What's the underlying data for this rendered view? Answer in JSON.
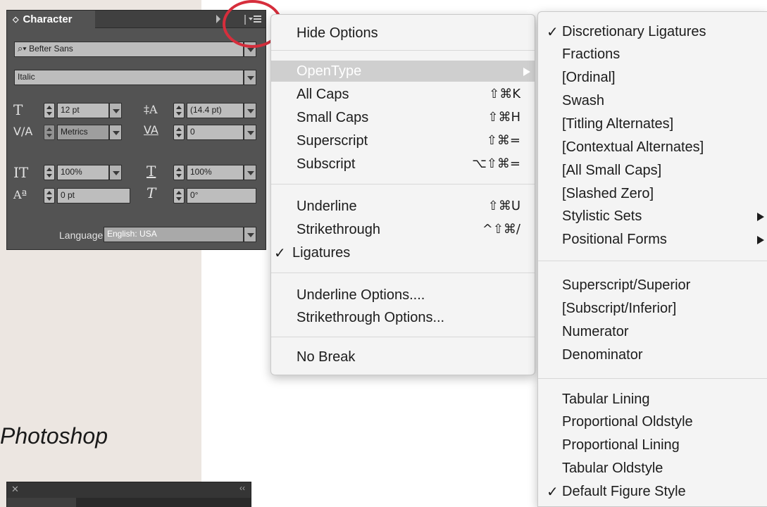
{
  "panel": {
    "title": "Character",
    "font_family": "Befter Sans",
    "font_style": "Italic",
    "font_size": "12 pt",
    "leading": "(14.4 pt)",
    "kerning": "Metrics",
    "tracking": "0",
    "vertical_scale": "100%",
    "horizontal_scale": "100%",
    "baseline_shift": "0 pt",
    "skew": "0°",
    "language_label": "Language:",
    "language_value": "English: USA"
  },
  "photoshop_label": "Photoshop",
  "menu_main": {
    "items": [
      {
        "label": "Hide Options",
        "shortcut": ""
      },
      {
        "label": "OpenType",
        "shortcut": ""
      },
      {
        "label": "All Caps",
        "shortcut": "⇧⌘K"
      },
      {
        "label": "Small Caps",
        "shortcut": "⇧⌘H"
      },
      {
        "label": "Superscript",
        "shortcut": "⇧⌘="
      },
      {
        "label": "Subscript",
        "shortcut": "⌥⇧⌘="
      },
      {
        "label": "Underline",
        "shortcut": "⇧⌘U"
      },
      {
        "label": "Strikethrough",
        "shortcut": "^⇧⌘/"
      },
      {
        "label": "Ligatures",
        "shortcut": "",
        "checked": true
      },
      {
        "label": "Underline Options....",
        "shortcut": ""
      },
      {
        "label": "Strikethrough Options...",
        "shortcut": ""
      },
      {
        "label": "No Break",
        "shortcut": ""
      }
    ]
  },
  "menu_opentype": {
    "items": [
      {
        "label": "Discretionary Ligatures",
        "checked": true
      },
      {
        "label": "Fractions"
      },
      {
        "label": "[Ordinal]"
      },
      {
        "label": "Swash"
      },
      {
        "label": "[Titling Alternates]"
      },
      {
        "label": "[Contextual Alternates]"
      },
      {
        "label": "[All Small Caps]"
      },
      {
        "label": "[Slashed Zero]"
      },
      {
        "label": "Stylistic Sets"
      },
      {
        "label": "Positional Forms"
      },
      {
        "label": "Superscript/Superior"
      },
      {
        "label": "[Subscript/Inferior]"
      },
      {
        "label": "Numerator"
      },
      {
        "label": "Denominator"
      },
      {
        "label": "Tabular Lining"
      },
      {
        "label": "Proportional Oldstyle"
      },
      {
        "label": "Proportional Lining"
      },
      {
        "label": "Tabular Oldstyle"
      },
      {
        "label": "Default Figure Style",
        "checked": true
      }
    ]
  },
  "check_glyph": "✓",
  "colors": {
    "panel_bg": "#535353",
    "highlight": "#d62e3c",
    "menu_bg": "#f4f4f4"
  }
}
